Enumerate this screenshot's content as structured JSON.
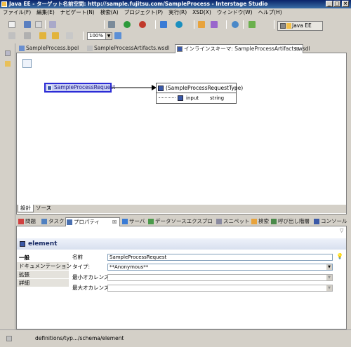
{
  "window": {
    "title": "Java EE - ターゲット名前空間: http://sample.fujitsu.com/SampleProcess - Interstage Studio",
    "minimize": "_",
    "maximize": "□",
    "close": "×"
  },
  "menu": [
    "ファイル(F)",
    "編集(E)",
    "ナビゲート(N)",
    "検索(A)",
    "プロジェクト(P)",
    "実行(R)",
    "XSD(X)",
    "ウィンドウ(W)",
    "ヘルプ(H)"
  ],
  "toolbar": {
    "zoom_value": "100%",
    "perspective_label": "Java EE"
  },
  "editor": {
    "tabs": [
      {
        "label": "SampleProcess.bpel",
        "icon": "bpel-file-icon"
      },
      {
        "label": "SampleProcessArtifacts.wsdl",
        "icon": "wsdl-file-icon"
      },
      {
        "label": "インラインスキーマ: SampleProcessArtifacts.wsdl",
        "icon": "schema-file-icon"
      }
    ],
    "bottom_tabs": [
      "設計",
      "ソース"
    ],
    "nodes": {
      "element_name": "SampleProcessRequest",
      "type_name": "(SampleProcessRequestType)",
      "field_name": "input",
      "field_type": "string"
    }
  },
  "views": {
    "tabs": [
      {
        "label": "問題",
        "icon": "problems-icon"
      },
      {
        "label": "タスク",
        "icon": "tasks-icon"
      },
      {
        "label": "プロパティ",
        "icon": "properties-icon"
      },
      {
        "label": "サーバ",
        "icon": "servers-icon"
      },
      {
        "label": "データソースエクスプロ",
        "icon": "datasource-icon"
      },
      {
        "label": "スニペット",
        "icon": "snippets-icon"
      },
      {
        "label": "検索",
        "icon": "search-icon"
      },
      {
        "label": "呼び出し階層",
        "icon": "call-hierarchy-icon"
      },
      {
        "label": "コンソール",
        "icon": "console-icon"
      }
    ]
  },
  "properties": {
    "title": "element",
    "side_tabs": [
      "一般",
      "ドキュメンテーション",
      "拡張",
      "詳細"
    ],
    "fields": [
      {
        "label": "名前",
        "value": "SampleProcessRequest"
      },
      {
        "label": "タイプ:",
        "value": "**Anonymous**"
      },
      {
        "label": "最小オカレンス:",
        "value": ""
      },
      {
        "label": "最大オカレンス:",
        "value": ""
      }
    ]
  },
  "status": {
    "path": "definitions/typ.../schema/element"
  },
  "colors": {
    "title_bar": "#0a246a",
    "selection_border": "#2b2bd6",
    "selection_fill": "#c6ccf2"
  }
}
